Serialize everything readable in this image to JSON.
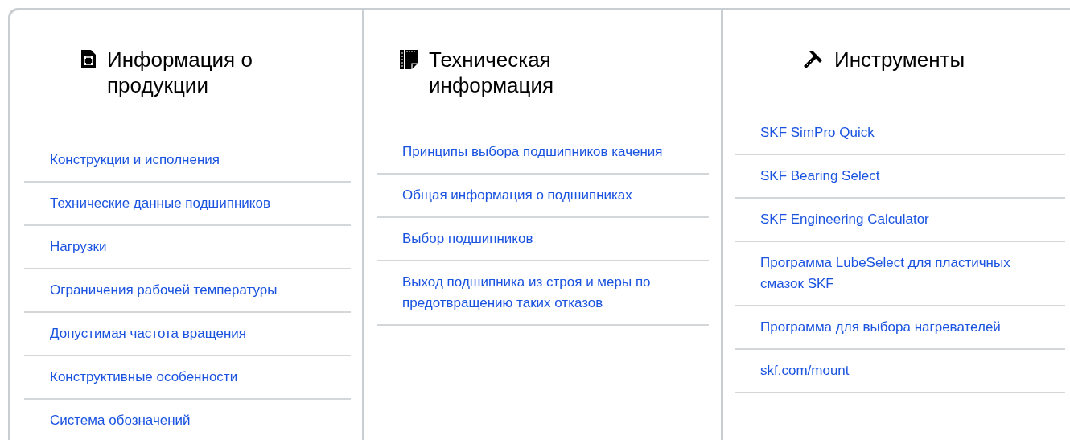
{
  "columns": [
    {
      "kind": "product",
      "title": "Информация о продукции",
      "links": [
        "Конструкции и исполнения",
        "Технические данные подшипников",
        "Нагрузки",
        "Ограничения рабочей температуры",
        "Допустимая частота вращения",
        "Конструктивные особенности",
        "Система обозначений"
      ]
    },
    {
      "kind": "technical",
      "title": "Техническая информация",
      "links": [
        "Принципы выбора подшипников качения",
        "Общая информация о подшипниках",
        "Выбор подшипников",
        "Выход подшипника из строя и меры по предотвращению таких отказов"
      ]
    },
    {
      "kind": "tools",
      "title": "Инструменты",
      "links": [
        "SKF SimPro Quick",
        "SKF Bearing Select",
        "SKF Engineering Calculator",
        "Программа LubeSelect для пластичных смазок SKF",
        "Программа для выбора нагревателей",
        "skf.com/mount"
      ]
    }
  ]
}
